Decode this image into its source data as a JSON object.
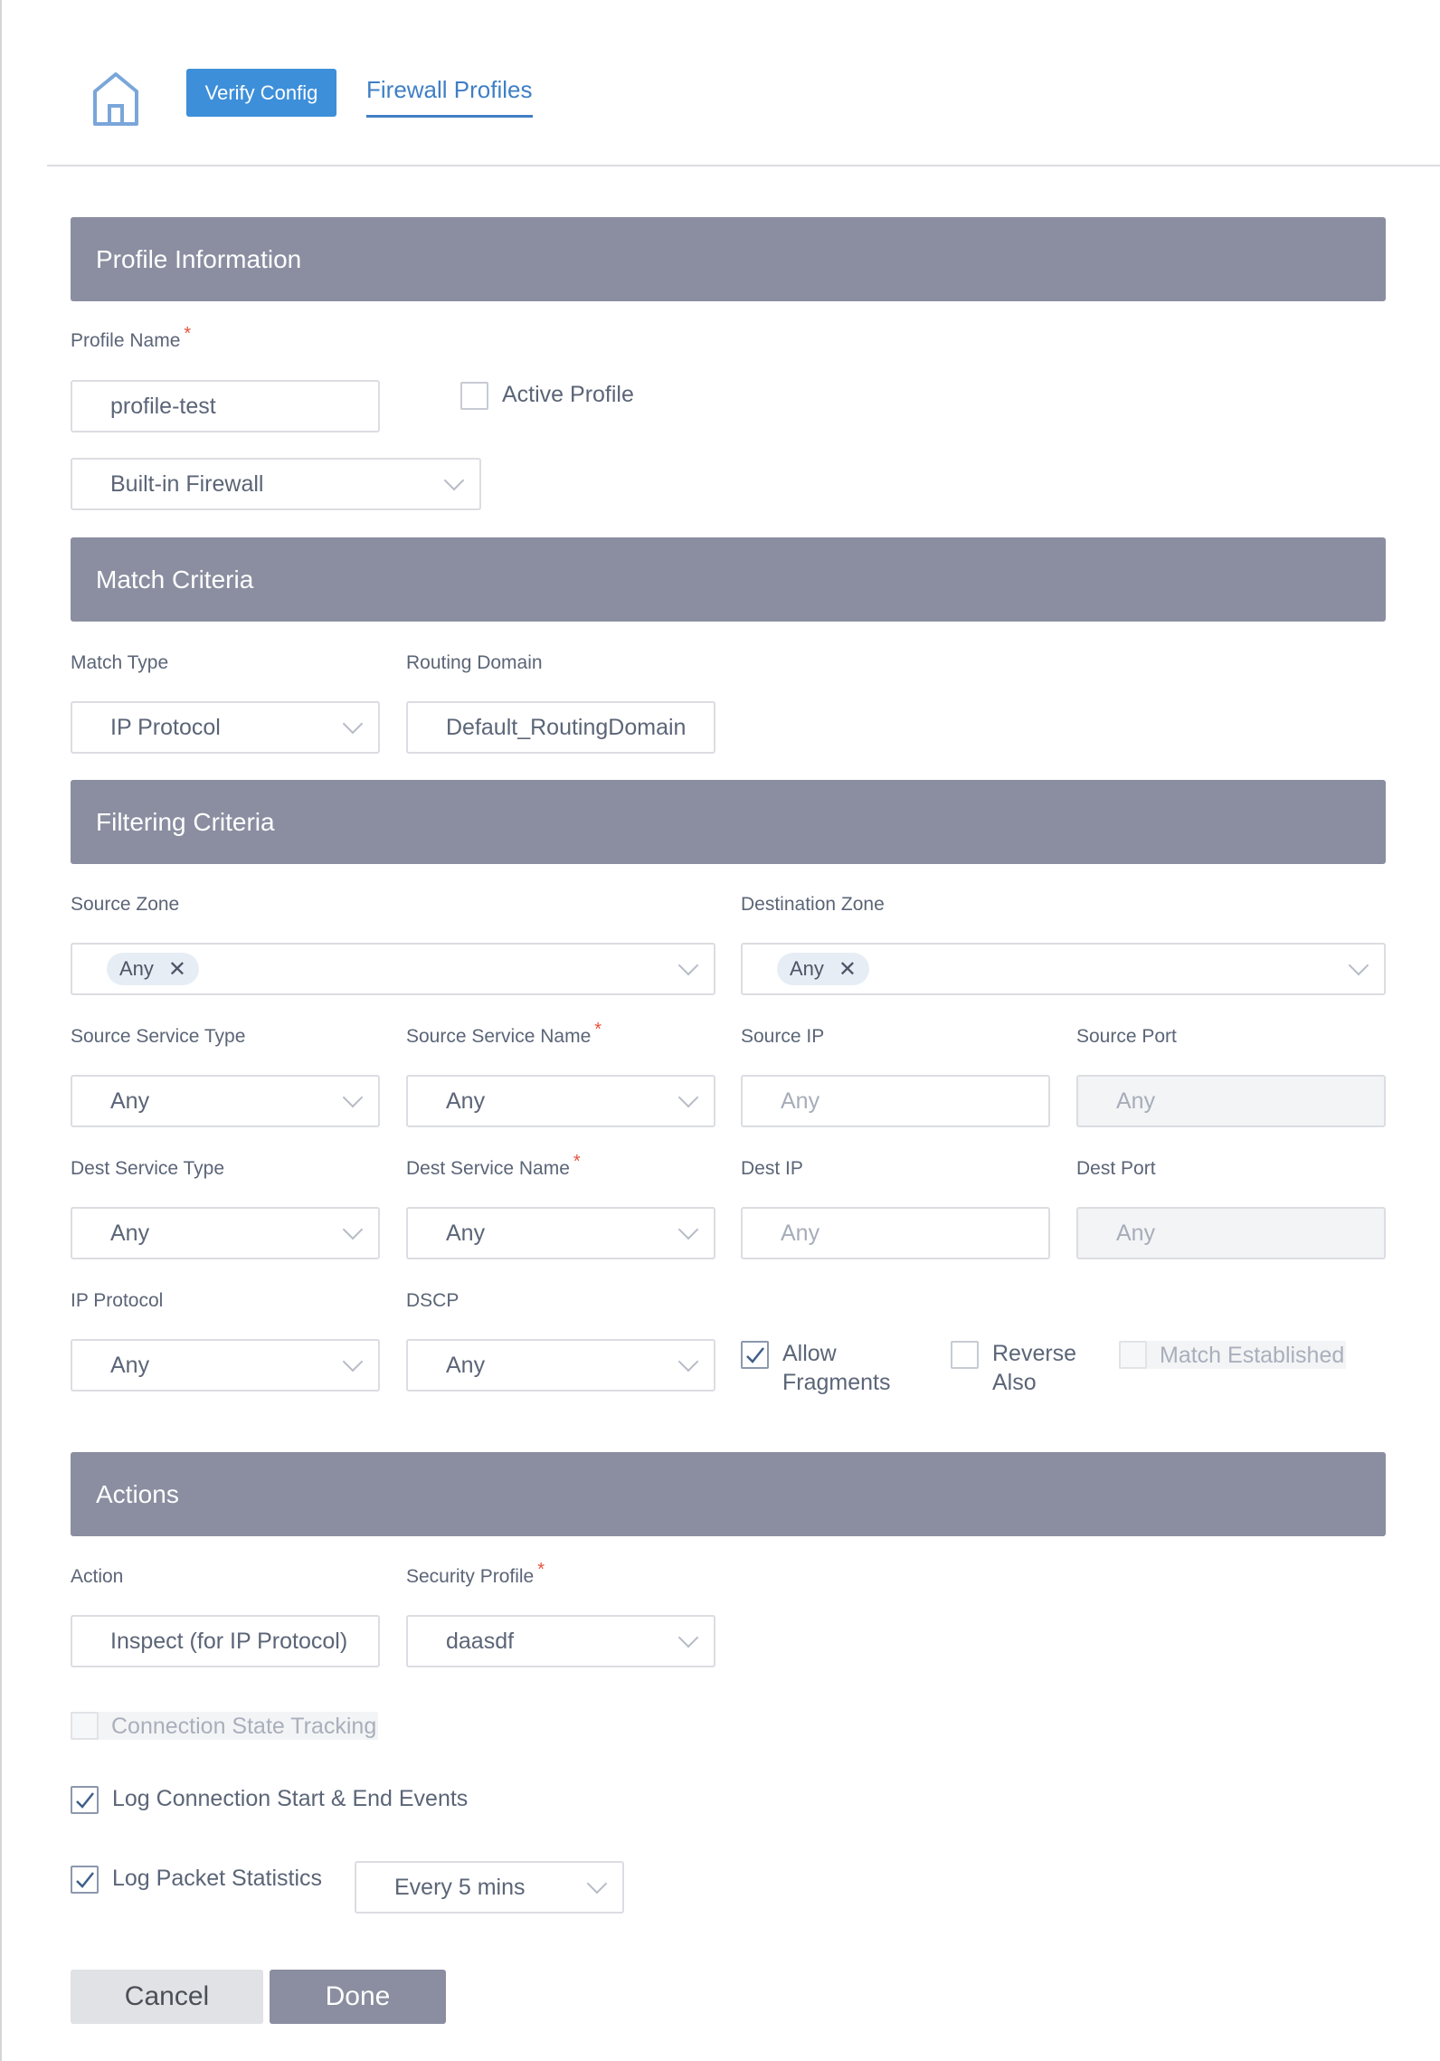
{
  "nav": {
    "home_icon": "home-icon",
    "verify_config": "Verify Config",
    "breadcrumb": "Firewall Profiles"
  },
  "colors": {
    "accent": "#3d8fda",
    "link": "#3f7fc5",
    "section_header": "#8a8ea0",
    "required": "#e5533d"
  },
  "sections": {
    "profile_info": "Profile Information",
    "match_criteria": "Match Criteria",
    "filtering_criteria": "Filtering Criteria",
    "actions": "Actions"
  },
  "profile": {
    "name_label": "Profile Name",
    "name_value": "profile-test",
    "active_label": "Active Profile",
    "active_checked": false,
    "firewall_type": "Built-in Firewall"
  },
  "match": {
    "match_type_label": "Match Type",
    "match_type_value": "IP Protocol",
    "routing_domain_label": "Routing Domain",
    "routing_domain_value": "Default_RoutingDomain"
  },
  "filtering": {
    "source_zone_label": "Source Zone",
    "source_zone_chip": "Any",
    "dest_zone_label": "Destination Zone",
    "dest_zone_chip": "Any",
    "source_service_type_label": "Source Service Type",
    "source_service_type_value": "Any",
    "source_service_name_label": "Source Service Name",
    "source_service_name_value": "Any",
    "source_ip_label": "Source IP",
    "source_ip_placeholder": "Any",
    "source_port_label": "Source Port",
    "source_port_placeholder": "Any",
    "dest_service_type_label": "Dest Service Type",
    "dest_service_type_value": "Any",
    "dest_service_name_label": "Dest Service Name",
    "dest_service_name_value": "Any",
    "dest_ip_label": "Dest IP",
    "dest_ip_placeholder": "Any",
    "dest_port_label": "Dest Port",
    "dest_port_placeholder": "Any",
    "ip_protocol_label": "IP Protocol",
    "ip_protocol_value": "Any",
    "dscp_label": "DSCP",
    "dscp_value": "Any",
    "allow_fragments_line1": "Allow",
    "allow_fragments_line2": "Fragments",
    "allow_fragments_checked": true,
    "reverse_also_line1": "Reverse",
    "reverse_also_line2": "Also",
    "reverse_also_checked": false,
    "match_established": "Match Established",
    "match_established_checked": false
  },
  "actions": {
    "action_label": "Action",
    "action_value": "Inspect (for IP Protocol)",
    "security_profile_label": "Security Profile",
    "security_profile_value": "daasdf",
    "connection_state_tracking": "Connection State Tracking",
    "connection_state_tracking_checked": false,
    "log_connection": "Log Connection Start & End Events",
    "log_connection_checked": true,
    "log_packet_stats": "Log Packet Statistics",
    "log_packet_stats_checked": true,
    "log_interval": "Every 5 mins"
  },
  "buttons": {
    "cancel": "Cancel",
    "done": "Done"
  },
  "required_mark": "*",
  "chip_remove": "✕"
}
